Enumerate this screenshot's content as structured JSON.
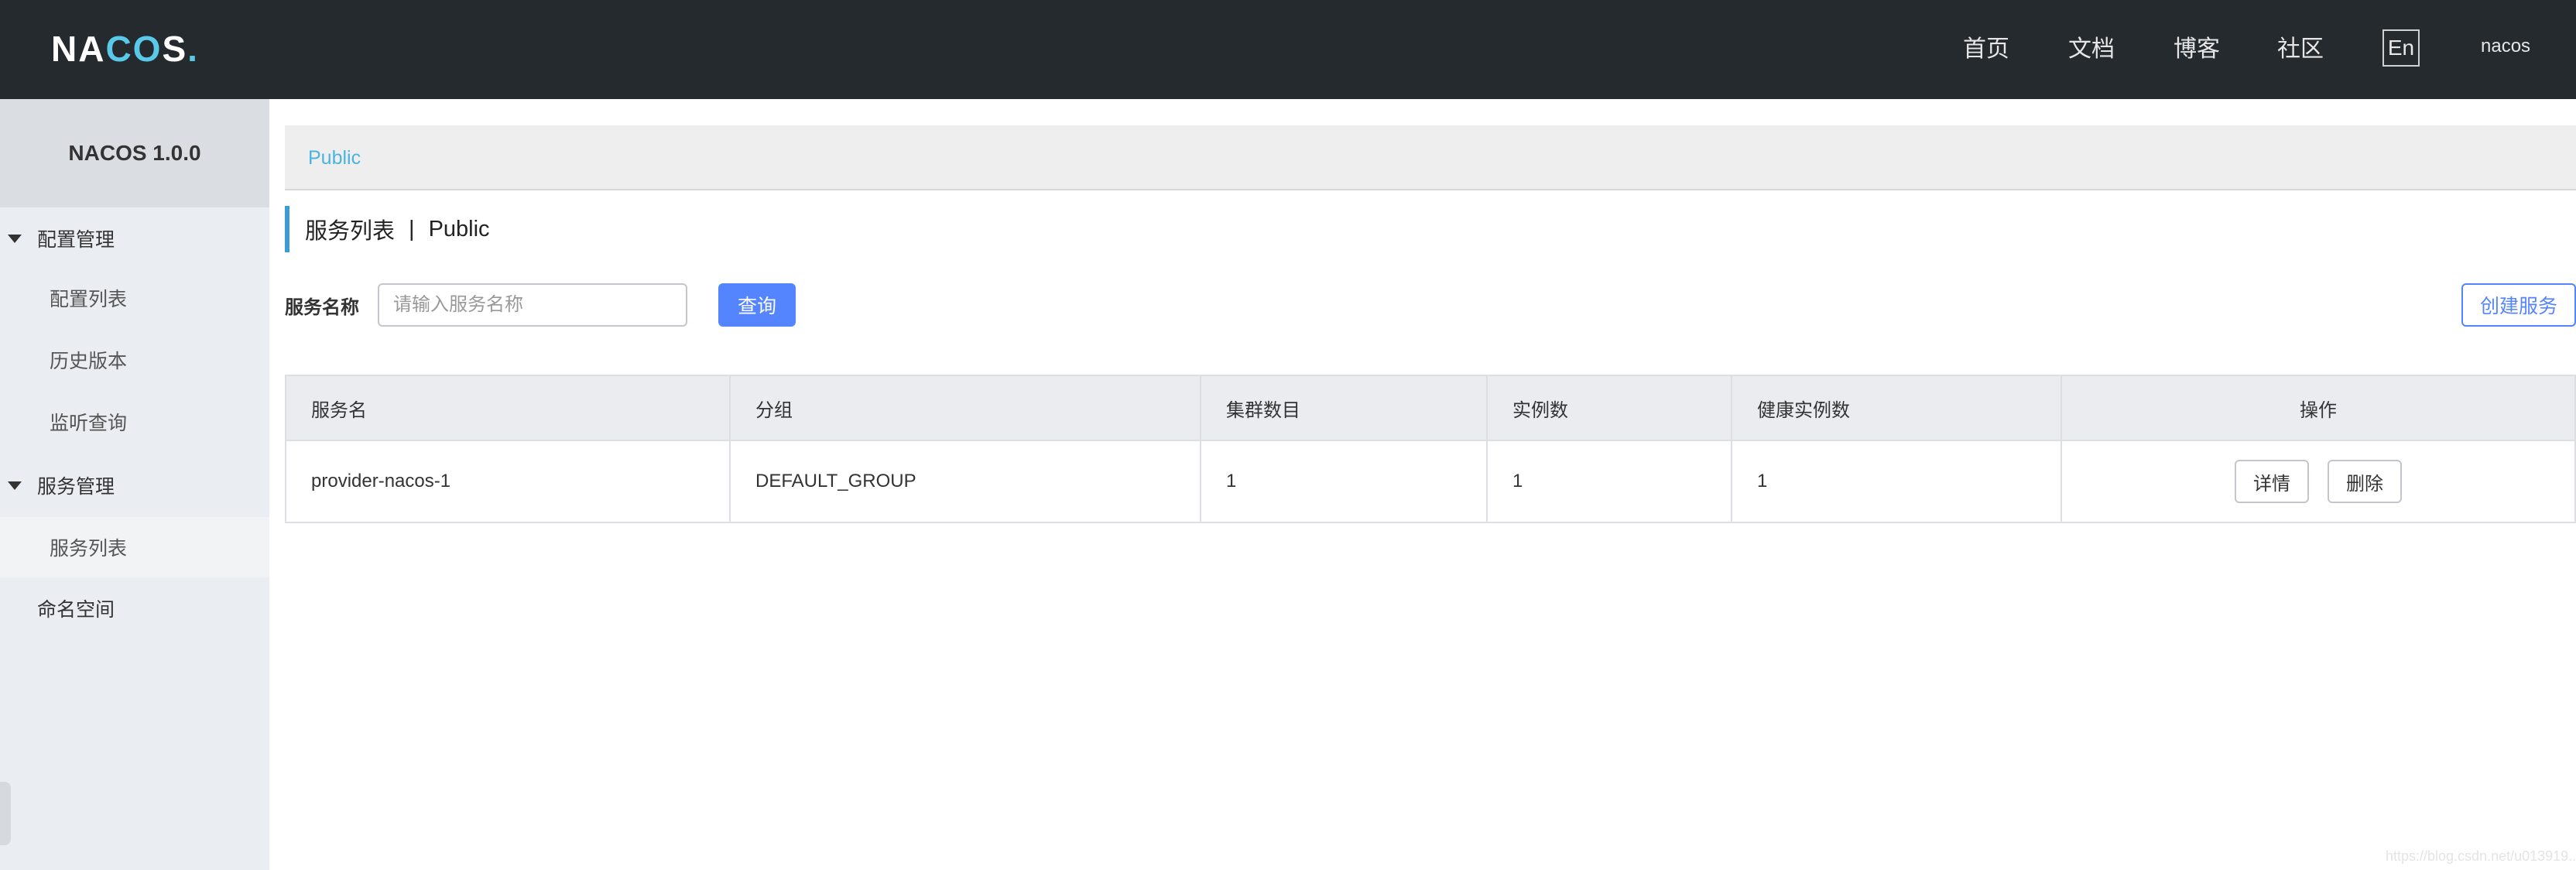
{
  "header": {
    "logo": {
      "part1": "NA",
      "part2": "CO",
      "part3": "S",
      "dot": "."
    },
    "nav": [
      {
        "label": "首页"
      },
      {
        "label": "文档"
      },
      {
        "label": "博客"
      },
      {
        "label": "社区"
      }
    ],
    "lang": "En",
    "user": "nacos"
  },
  "sidebar": {
    "title": "NACOS 1.0.0",
    "groups": [
      {
        "label": "配置管理",
        "items": [
          {
            "label": "配置列表"
          },
          {
            "label": "历史版本"
          },
          {
            "label": "监听查询"
          }
        ]
      },
      {
        "label": "服务管理",
        "items": [
          {
            "label": "服务列表"
          }
        ]
      }
    ],
    "namespace": "命名空间"
  },
  "main": {
    "breadcrumb": "Public",
    "title": "服务列表",
    "title_sep": "|",
    "title_ns": "Public",
    "search": {
      "label": "服务名称",
      "placeholder": "请输入服务名称",
      "query_label": "查询",
      "create_label": "创建服务"
    },
    "table": {
      "columns": [
        "服务名",
        "分组",
        "集群数目",
        "实例数",
        "健康实例数",
        "操作"
      ],
      "rows": [
        {
          "name": "provider-nacos-1",
          "group": "DEFAULT_GROUP",
          "clusters": "1",
          "instances": "1",
          "healthy": "1",
          "detail": "详情",
          "delete": "删除"
        }
      ]
    }
  },
  "colors": {
    "header_bg": "#252a2f",
    "sidebar_bg": "#eaedf1",
    "accent": "#5584ff",
    "breadcrumb": "#4ab3e0"
  },
  "watermark": "https://blog.csdn.net/u013919..."
}
